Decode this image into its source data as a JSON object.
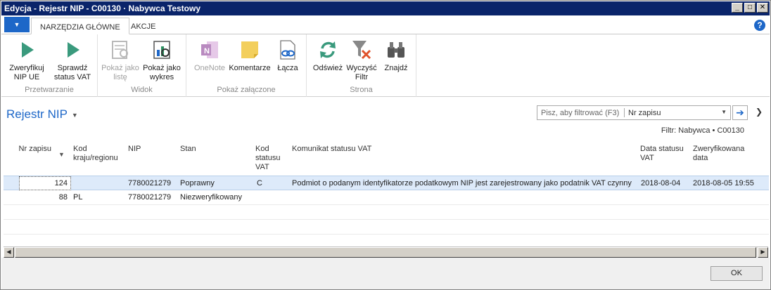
{
  "window": {
    "title": "Edycja - Rejestr NIP - C00130 · Nabywca Testowy"
  },
  "tabs": [
    "NARZĘDZIA GŁÓWNE",
    "AKCJE"
  ],
  "ribbon": {
    "groups": [
      {
        "label": "Przetwarzanie",
        "buttons": [
          {
            "label": "Zweryfikuj NIP UE",
            "icon": "play-icon"
          },
          {
            "label": "Sprawdź status VAT",
            "icon": "play-icon"
          }
        ]
      },
      {
        "label": "Widok",
        "buttons": [
          {
            "label": "Pokaż jako listę",
            "icon": "list-view-icon",
            "disabled": true
          },
          {
            "label": "Pokaż jako wykres",
            "icon": "chart-view-icon"
          }
        ]
      },
      {
        "label": "Pokaż załączone",
        "buttons": [
          {
            "label": "OneNote",
            "icon": "onenote-icon",
            "disabled": true
          },
          {
            "label": "Komentarze",
            "icon": "note-icon"
          },
          {
            "label": "Łącza",
            "icon": "link-icon"
          }
        ]
      },
      {
        "label": "Strona",
        "buttons": [
          {
            "label": "Odśwież",
            "icon": "refresh-icon"
          },
          {
            "label": "Wyczyść Filtr",
            "icon": "clear-filter-icon"
          },
          {
            "label": "Znajdź",
            "icon": "binoculars-icon"
          }
        ]
      }
    ]
  },
  "page": {
    "title": "Rejestr NIP"
  },
  "search": {
    "placeholder": "Pisz, aby filtrować (F3)",
    "field": "Nr zapisu"
  },
  "filter": "Filtr: Nabywca • C00130",
  "columns": [
    "Nr zapisu",
    "Kod kraju/regionu",
    "NIP",
    "Stan",
    "Kod statusu VAT",
    "Komunikat statusu VAT",
    "Data statusu VAT",
    "Zweryfikowana data"
  ],
  "rows": [
    {
      "nr": "124",
      "kraj": "",
      "nip": "7780021279",
      "stan": "Poprawny",
      "kod": "C",
      "komunikat": "Podmiot o podanym identyfikatorze podatkowym NIP jest zarejestrowany jako podatnik VAT czynny",
      "data": "2018-08-04",
      "zweryf": "2018-08-05 19:55"
    },
    {
      "nr": "88",
      "kraj": "PL",
      "nip": "7780021279",
      "stan": "Niezweryfikowany",
      "kod": "",
      "komunikat": "",
      "data": "",
      "zweryf": ""
    }
  ],
  "footer": {
    "ok": "OK"
  },
  "colors": {
    "accent": "#1d67c8",
    "selected_row": "#ddeafa",
    "title_bar": "#0a246a"
  }
}
